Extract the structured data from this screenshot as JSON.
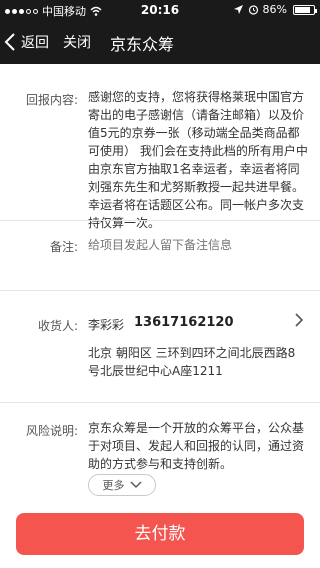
{
  "status_bar": {
    "carrier": "中国移动",
    "time": "20:16",
    "battery": "86%",
    "battery_level": 0.86,
    "signal_bars": 3,
    "signal_bars_total": 5
  },
  "nav": {
    "back_label": "返回",
    "close_label": "关闭",
    "title": "京东众筹",
    "back_icon": "chevron-left-icon"
  },
  "reward": {
    "label": "回报内容:",
    "text": "感谢您的支持，您将获得格莱珉中国官方寄出的电子感谢信（请备注邮箱）以及价值5元的京券一张（移动端全品类商品都可使用） 我们会在支持此档的所有用户中由京东官方抽取1名幸运者，幸运者将同刘强东先生和尤努斯教授一起共进早餐。幸运者将在话题区公布。同一帐户多次支持仅算一次。"
  },
  "remark": {
    "label": "备注:",
    "placeholder": "给项目发起人留下备注信息"
  },
  "receiver": {
    "label": "收货人:",
    "name": "李彩彩",
    "phone": "13617162120",
    "address": "北京 朝阳区 三环到四环之间北辰西路8号北辰世纪中心A座1211",
    "arrow_icon": "chevron-right-icon"
  },
  "risk": {
    "label": "风险说明:",
    "text": "京东众筹是一个开放的众筹平台，公众基于对项目、发起人和回报的认同，通过资助的方式参与和支持创新。",
    "more_label": "更多",
    "more_icon": "chevron-down-icon"
  },
  "pay": {
    "label": "去付款",
    "color": "#f5554f"
  }
}
